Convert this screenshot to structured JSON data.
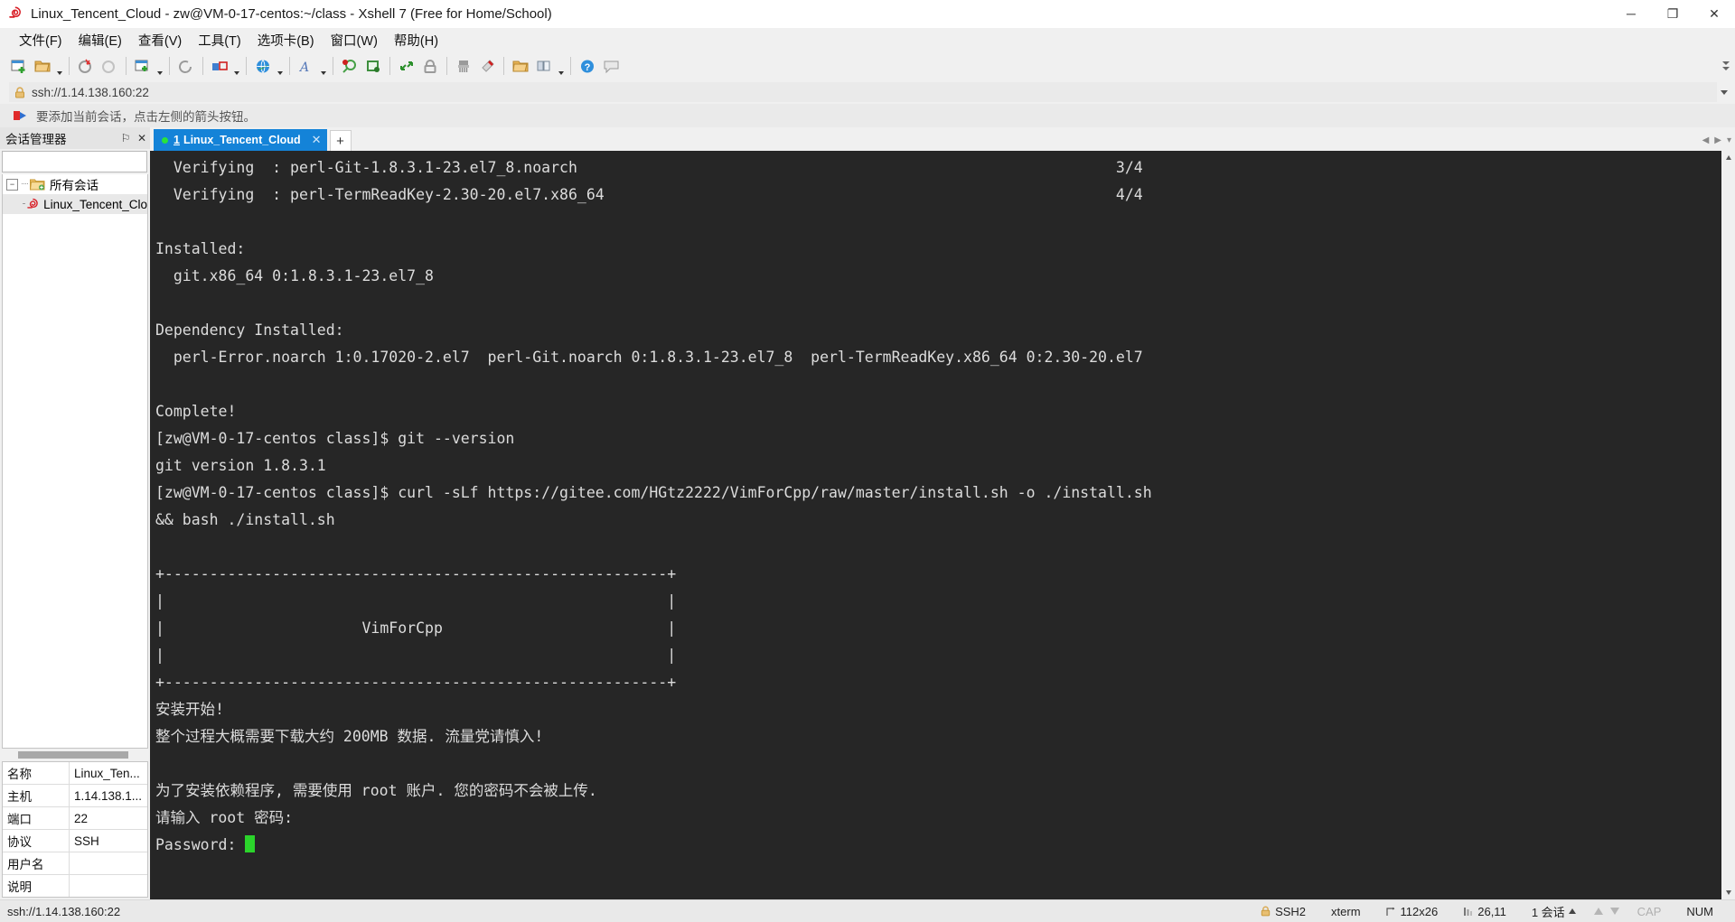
{
  "window": {
    "title": "Linux_Tencent_Cloud - zw@VM-0-17-centos:~/class - Xshell 7 (Free for Home/School)",
    "minimize": "─",
    "maximize": "❐",
    "close": "✕"
  },
  "menubar": {
    "items": [
      {
        "label": "文件(F)",
        "name": "menu-file"
      },
      {
        "label": "编辑(E)",
        "name": "menu-edit"
      },
      {
        "label": "查看(V)",
        "name": "menu-view"
      },
      {
        "label": "工具(T)",
        "name": "menu-tools"
      },
      {
        "label": "选项卡(B)",
        "name": "menu-tabs"
      },
      {
        "label": "窗口(W)",
        "name": "menu-window"
      },
      {
        "label": "帮助(H)",
        "name": "menu-help"
      }
    ]
  },
  "toolbar": {
    "icons": [
      "new-session-icon",
      "open-folder-icon",
      "disconnect-icon",
      "reconnect-icon",
      "new-tab-icon",
      "refresh-icon",
      "transfer-icon",
      "browser-icon",
      "font-icon",
      "find-icon",
      "log-icon",
      "fullscreen-icon",
      "lock-icon",
      "clear-icon",
      "highlight-icon",
      "folder-transfer-icon",
      "layout-icon",
      "help-icon",
      "comment-icon"
    ]
  },
  "address": {
    "value": "ssh://1.14.138.160:22",
    "icon": "lock-icon"
  },
  "notice": {
    "text": "要添加当前会话，点击左侧的箭头按钮。",
    "icon": "arrow-flag-icon"
  },
  "sidebar": {
    "title": "会话管理器",
    "pin_label": "⚐",
    "close_label": "✕",
    "search_placeholder": "",
    "search_value": "",
    "tree": [
      {
        "label": "所有会话",
        "icon": "folder-sessions-icon",
        "level": 0,
        "expanded": true
      },
      {
        "label": "Linux_Tencent_Clo",
        "icon": "snail-session-icon",
        "level": 1,
        "selected": true
      }
    ],
    "properties": [
      {
        "key": "名称",
        "value": "Linux_Ten..."
      },
      {
        "key": "主机",
        "value": "1.14.138.1..."
      },
      {
        "key": "端口",
        "value": "22"
      },
      {
        "key": "协议",
        "value": "SSH"
      },
      {
        "key": "用户名",
        "value": ""
      },
      {
        "key": "说明",
        "value": ""
      }
    ]
  },
  "tabs": {
    "items": [
      {
        "number": "1",
        "label": "Linux_Tencent_Cloud",
        "status": "connected",
        "close_label": "✕"
      }
    ],
    "add_label": "+"
  },
  "terminal": {
    "lines": [
      "  Verifying  : perl-Git-1.8.3.1-23.el7_8.noarch                                                            3/4",
      "  Verifying  : perl-TermReadKey-2.30-20.el7.x86_64                                                         4/4",
      "",
      "Installed:",
      "  git.x86_64 0:1.8.3.1-23.el7_8",
      "",
      "Dependency Installed:",
      "  perl-Error.noarch 1:0.17020-2.el7  perl-Git.noarch 0:1.8.3.1-23.el7_8  perl-TermReadKey.x86_64 0:2.30-20.el7",
      "",
      "Complete!",
      "[zw@VM-0-17-centos class]$ git --version",
      "git version 1.8.3.1",
      "[zw@VM-0-17-centos class]$ curl -sLf https://gitee.com/HGtz2222/VimForCpp/raw/master/install.sh -o ./install.sh",
      "&& bash ./install.sh",
      "",
      "+--------------------------------------------------------+",
      "|                                                        |",
      "|                      VimForCpp                         |",
      "|                                                        |",
      "+--------------------------------------------------------+",
      "安装开始!",
      "整个过程大概需要下载大约 200MB 数据. 流量党请慎入!",
      "",
      "为了安装依赖程序, 需要使用 root 账户. 您的密码不会被上传.",
      "请输入 root 密码:",
      "Password: "
    ]
  },
  "statusbar": {
    "left": "ssh://1.14.138.160:22",
    "protocol": "SSH2",
    "termtype": "xterm",
    "size": "112x26",
    "cursor": "26,11",
    "sessions": "1 会话",
    "cap": "CAP",
    "num": "NUM"
  }
}
